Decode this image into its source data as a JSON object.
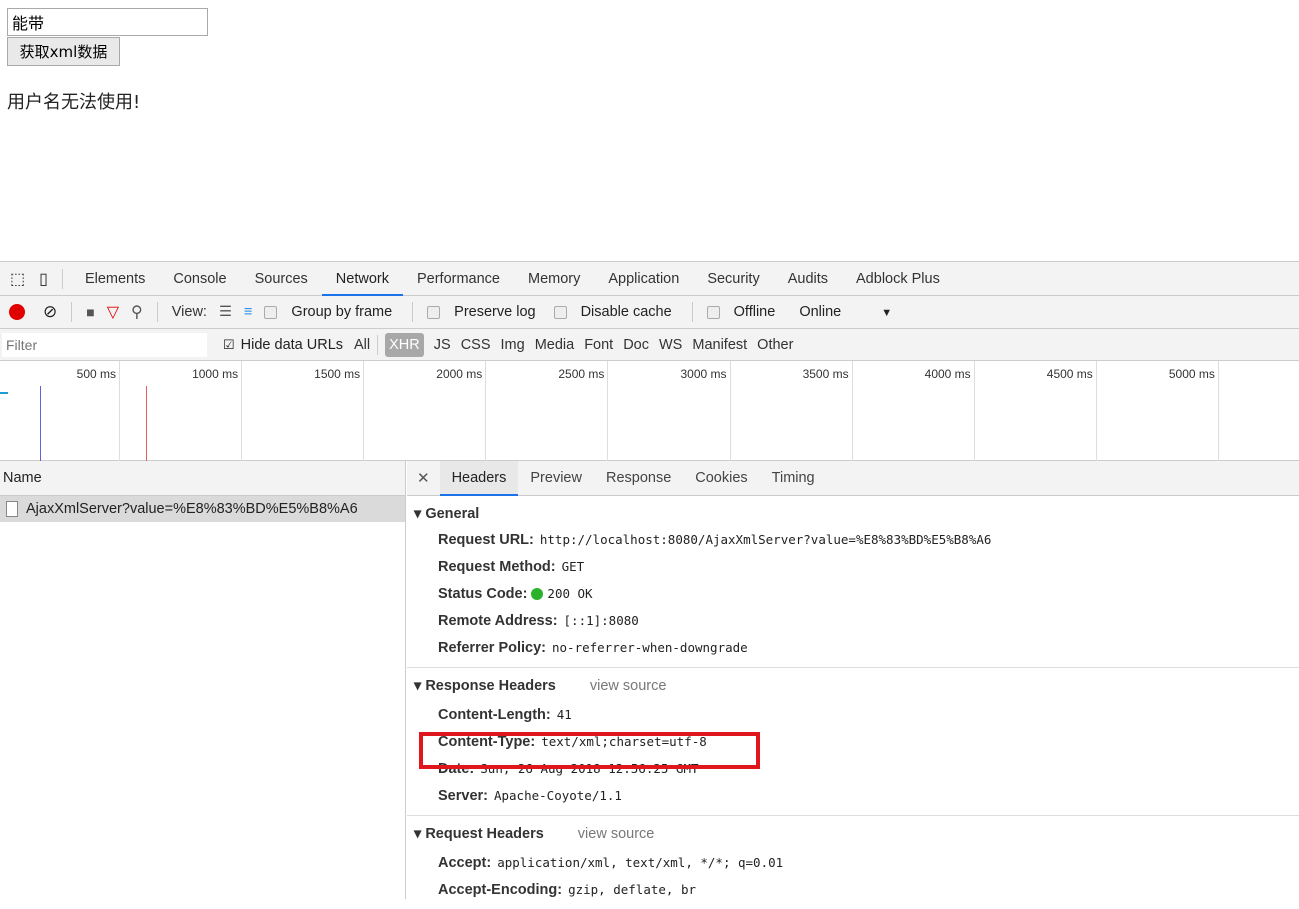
{
  "page": {
    "input_value": "能带",
    "button_label": "获取xml数据",
    "message": "用户名无法使用!"
  },
  "devtools": {
    "tabs": [
      "Elements",
      "Console",
      "Sources",
      "Network",
      "Performance",
      "Memory",
      "Application",
      "Security",
      "Audits",
      "Adblock Plus"
    ],
    "active_tab": "Network",
    "toolbar": {
      "view_label": "View:",
      "group_by_frame": "Group by frame",
      "preserve_log": "Preserve log",
      "disable_cache": "Disable cache",
      "offline": "Offline",
      "throttle": "Online"
    },
    "filter": {
      "placeholder": "Filter",
      "hide_data_urls": "Hide data URLs",
      "types": [
        "All",
        "XHR",
        "JS",
        "CSS",
        "Img",
        "Media",
        "Font",
        "Doc",
        "WS",
        "Manifest",
        "Other"
      ],
      "selected": "XHR"
    },
    "timeline_ticks": [
      "500 ms",
      "1000 ms",
      "1500 ms",
      "2000 ms",
      "2500 ms",
      "3000 ms",
      "3500 ms",
      "4000 ms",
      "4500 ms",
      "5000 ms",
      "5"
    ],
    "name_header": "Name",
    "requests": [
      "AjaxXmlServer?value=%E8%83%BD%E5%B8%A6"
    ],
    "detail_tabs": [
      "Headers",
      "Preview",
      "Response",
      "Cookies",
      "Timing"
    ],
    "general": {
      "title": "General",
      "rows": [
        {
          "k": "Request URL:",
          "v": "http://localhost:8080/AjaxXmlServer?value=%E8%83%BD%E5%B8%A6"
        },
        {
          "k": "Request Method:",
          "v": "GET"
        },
        {
          "k": "Status Code:",
          "v": "200 OK"
        },
        {
          "k": "Remote Address:",
          "v": "[::1]:8080"
        },
        {
          "k": "Referrer Policy:",
          "v": "no-referrer-when-downgrade"
        }
      ]
    },
    "response_headers": {
      "title": "Response Headers",
      "view_source": "view source",
      "rows": [
        {
          "k": "Content-Length:",
          "v": "41"
        },
        {
          "k": "Content-Type:",
          "v": "text/xml;charset=utf-8"
        },
        {
          "k": "Date:",
          "v": "Sun, 26 Aug 2018 12:56:25 GMT"
        },
        {
          "k": "Server:",
          "v": "Apache-Coyote/1.1"
        }
      ]
    },
    "request_headers": {
      "title": "Request Headers",
      "view_source": "view source",
      "rows": [
        {
          "k": "Accept:",
          "v": "application/xml, text/xml, */*; q=0.01"
        },
        {
          "k": "Accept-Encoding:",
          "v": "gzip, deflate, br"
        }
      ]
    }
  },
  "colors": {
    "highlight": "#e0161f",
    "record": "#e00000",
    "status_ok": "#2ab32a",
    "active_tab": "#1a73e8"
  }
}
